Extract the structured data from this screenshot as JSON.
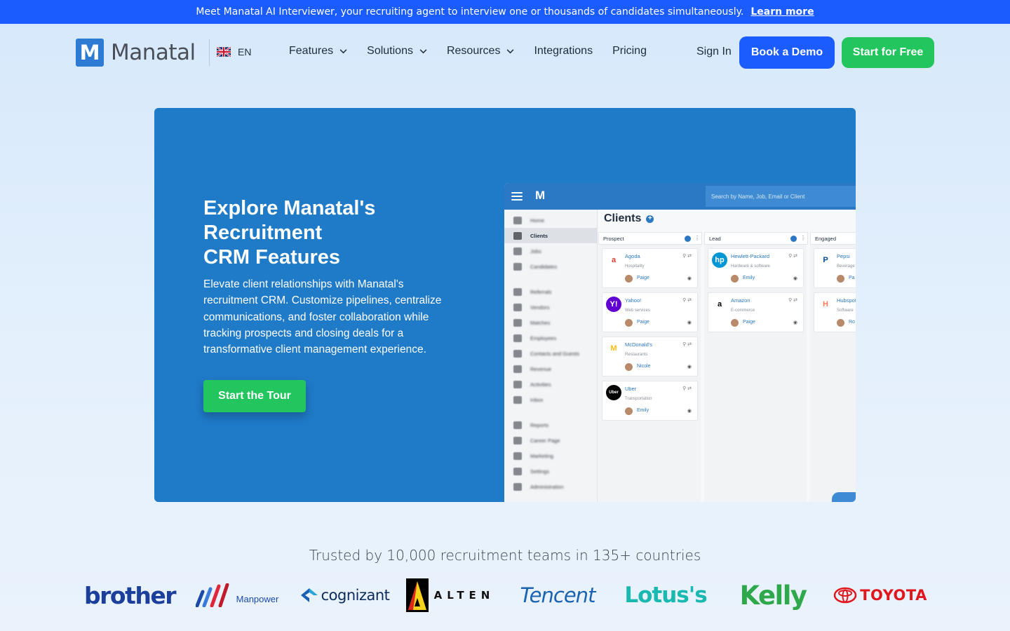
{
  "announcement": {
    "message": "Meet Manatal AI Interviewer, your recruiting agent to interview one or thousands of candidates simultaneously.",
    "link": "Learn more"
  },
  "header": {
    "logo_letter": "M",
    "logo_text": "Manatal",
    "language": "EN",
    "nav": [
      {
        "label": "Features",
        "dropdown": true
      },
      {
        "label": "Solutions",
        "dropdown": true
      },
      {
        "label": "Resources",
        "dropdown": true
      },
      {
        "label": "Integrations",
        "dropdown": false
      },
      {
        "label": "Pricing",
        "dropdown": false
      }
    ],
    "sign_in": "Sign In",
    "book_demo": "Book a Demo",
    "start_free": "Start for Free"
  },
  "hero": {
    "title_lines": [
      "Explore Manatal's",
      "Recruitment",
      "CRM Features"
    ],
    "description": "Elevate client relationships with Manatal's recruitment CRM. Customize pipelines, centralize communications, and foster collaboration while tracking prospects and closing deals for a transformative client management experience.",
    "cta": "Start the Tour"
  },
  "app_mock": {
    "brand": "M",
    "search_placeholder": "Search by Name, Job, Email or Client",
    "sidebar": [
      "Home",
      "Clients",
      "Jobs",
      "Candidates",
      "Referrals",
      "Vendors",
      "Matches",
      "Employees",
      "Contacts and Guests",
      "Revenue",
      "Activities",
      "Inbox",
      "Reports",
      "Career Page",
      "Marketing",
      "Settings",
      "Administration"
    ],
    "active_item": "Clients",
    "page_title": "Clients",
    "stages": [
      "Prospect",
      "Lead",
      "Engaged"
    ],
    "cards": [
      {
        "col": 0,
        "name": "Agoda",
        "industry": "Hospitality",
        "user": "Paige",
        "logo": "a",
        "logo_color": "#ffffff",
        "text_color": "#e23a2f"
      },
      {
        "col": 0,
        "name": "Yahoo!",
        "industry": "Web services",
        "user": "Paige",
        "logo": "Y!",
        "logo_color": "#6001d2",
        "text_color": "#ffffff"
      },
      {
        "col": 0,
        "name": "McDonald's",
        "industry": "Restaurants",
        "user": "Nicole",
        "logo": "M",
        "logo_color": "#ffffff",
        "text_color": "#ffbc0d"
      },
      {
        "col": 0,
        "name": "Uber",
        "industry": "Transportation",
        "user": "Emily",
        "logo": "Uber",
        "logo_color": "#000000",
        "text_color": "#ffffff"
      },
      {
        "col": 1,
        "name": "Hewlett-Packard",
        "industry": "Hardware & software",
        "user": "Emily",
        "logo": "hp",
        "logo_color": "#0096d6",
        "text_color": "#ffffff"
      },
      {
        "col": 1,
        "name": "Amazon",
        "industry": "E-commerce",
        "user": "Paige",
        "logo": "a",
        "logo_color": "#ffffff",
        "text_color": "#000000"
      },
      {
        "col": 2,
        "name": "Pepsi",
        "industry": "Beverage",
        "user": "Pa",
        "logo": "P",
        "logo_color": "#ffffff",
        "text_color": "#004b93"
      },
      {
        "col": 2,
        "name": "Hubspot",
        "industry": "Software",
        "user": "Ro",
        "logo": "H",
        "logo_color": "#ffffff",
        "text_color": "#ff7a59"
      }
    ]
  },
  "trusted": {
    "text": "Trusted by 10,000 recruitment teams in 135+ countries",
    "logos": [
      "brother",
      "Manpower",
      "cognizant",
      "ALTEN",
      "Tencent",
      "Lotus's",
      "Kelly",
      "TOYOTA"
    ]
  },
  "colors": {
    "primary_blue": "#1a5cff",
    "green": "#22c55e",
    "hero_blue": "#1f7ac8"
  }
}
